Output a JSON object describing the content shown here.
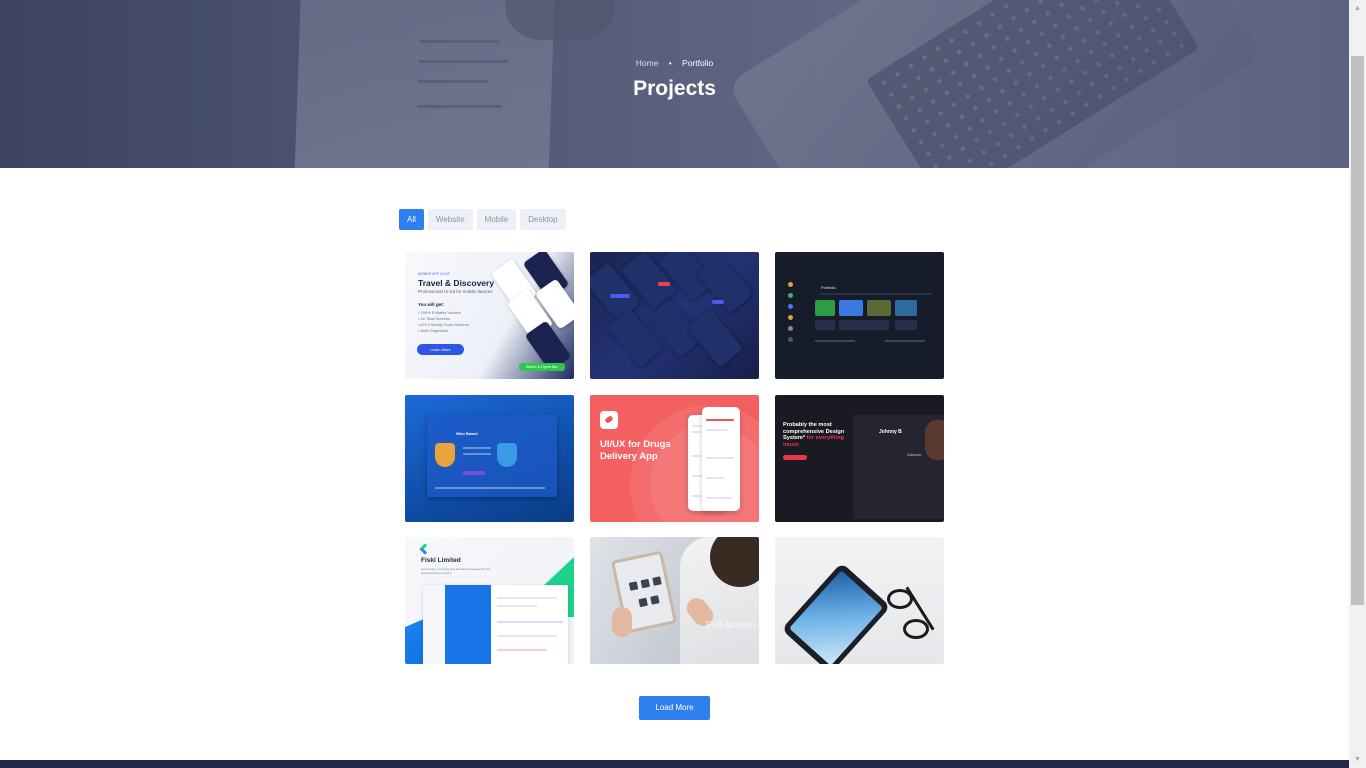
{
  "breadcrumb": {
    "home": "Home",
    "separator": "•",
    "current": "Portfolio"
  },
  "page_title": "Projects",
  "filters": [
    {
      "label": "All",
      "active": true
    },
    {
      "label": "Website",
      "active": false
    },
    {
      "label": "Mobile",
      "active": false
    },
    {
      "label": "Desktop",
      "active": false
    }
  ],
  "projects": [
    {
      "tag": "MOBILE APP UI KIT",
      "title": "Travel & Discovery",
      "subtitle": "Professional UI Kit for mobile devices",
      "heading": "You will get:",
      "items": [
        "• 100% Editable Vectors",
        "• 40 Total Screens",
        "• iOS Friendly Color Scheme",
        "• Well Organized"
      ],
      "button": "Learn More",
      "badge": "Sketch & Figma files"
    },
    {
      "theme": "dark-mobile-screens"
    },
    {
      "title": "Portfolio"
    },
    {
      "title": "Wiro Bowel"
    },
    {
      "title": "UI/UX for Drugs Delivery App"
    },
    {
      "title_part1": "Probably the most comprehensive Design System*",
      "title_part2": "for everything music",
      "name": "Johnny B",
      "label": "Discover"
    },
    {
      "title": "Fiskl Limited",
      "subtitle": "Accounting, invoicing and business management for small business owners"
    },
    {
      "theme": "tablet-in-hands-photo"
    },
    {
      "theme": "phone-and-glasses-photo"
    }
  ],
  "watermark": "Full-screen Snip",
  "load_more": "Load More",
  "scroll": {
    "up": "▲",
    "down": "▼"
  },
  "colors": {
    "accent": "#2d7ff0",
    "hero": "#5a6281",
    "footer": "#1f2a44"
  }
}
